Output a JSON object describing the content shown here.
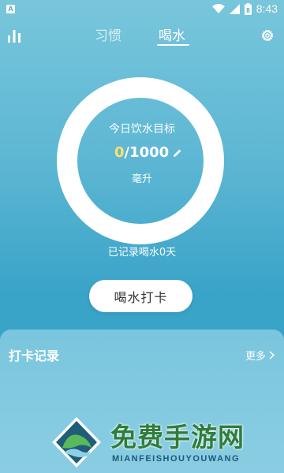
{
  "status_bar": {
    "notification_icon": "A",
    "time": "8:43",
    "battery_level": "8"
  },
  "header": {
    "tabs": [
      {
        "label": "习惯",
        "active": false
      },
      {
        "label": "喝水",
        "active": true
      }
    ],
    "left_icon": "bar-chart-icon",
    "right_icon": "gear-icon"
  },
  "water": {
    "ring_title": "今日饮水目标",
    "current": "0",
    "goal": "/1000",
    "unit": "毫升",
    "record_days": "已记录喝水0天",
    "checkin_label": "喝水打卡",
    "current_color": "#ffe26c"
  },
  "records": {
    "title": "打卡记录",
    "more_label": "更多"
  },
  "watermark": {
    "title": "免费手游网",
    "subtitle": "MIANFEISHOUYOUWANG"
  },
  "colors": {
    "background": "#4fb1d0",
    "panel": "#7ac6de",
    "accent": "#ffe26c"
  }
}
